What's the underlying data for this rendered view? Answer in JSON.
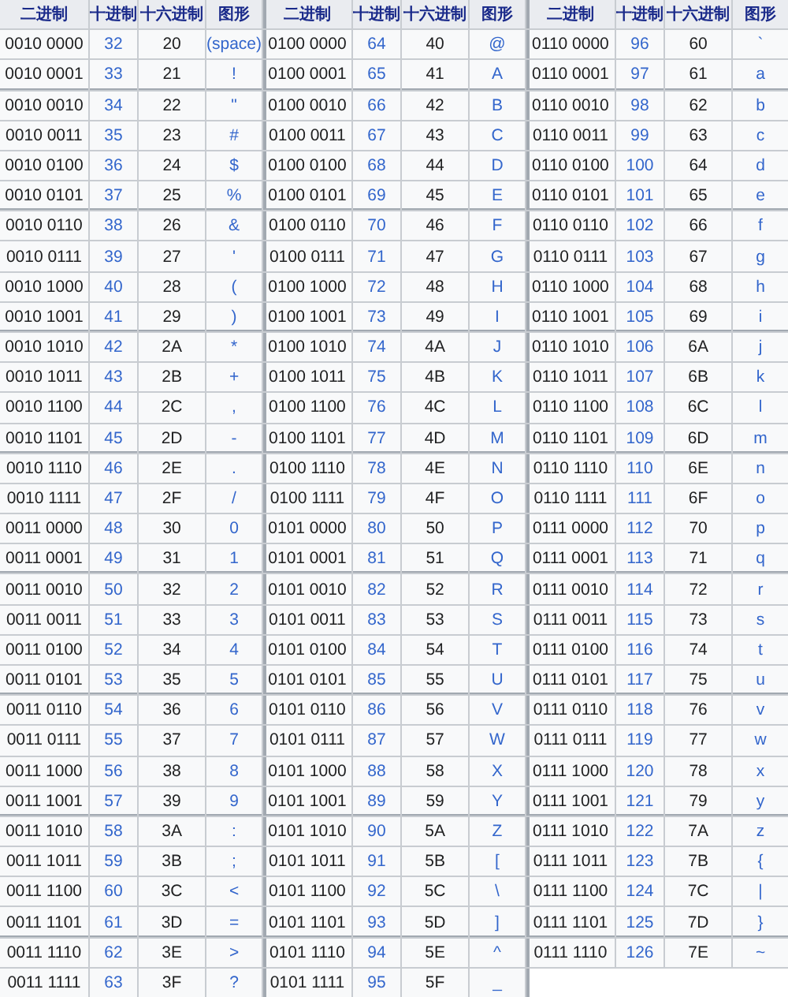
{
  "groups": [
    {
      "columns": [
        "二进制",
        "十进制",
        "十六进制",
        "图形"
      ],
      "rows": [
        [
          "0010 0000",
          "32",
          "20",
          "(space)"
        ],
        [
          "0010 0001",
          "33",
          "21",
          "!"
        ],
        [
          "0010 0010",
          "34",
          "22",
          "\""
        ],
        [
          "0010 0011",
          "35",
          "23",
          "#"
        ],
        [
          "0010 0100",
          "36",
          "24",
          "$"
        ],
        [
          "0010 0101",
          "37",
          "25",
          "%"
        ],
        [
          "0010 0110",
          "38",
          "26",
          "&"
        ],
        [
          "0010 0111",
          "39",
          "27",
          "'"
        ],
        [
          "0010 1000",
          "40",
          "28",
          "("
        ],
        [
          "0010 1001",
          "41",
          "29",
          ")"
        ],
        [
          "0010 1010",
          "42",
          "2A",
          "*"
        ],
        [
          "0010 1011",
          "43",
          "2B",
          "+"
        ],
        [
          "0010 1100",
          "44",
          "2C",
          ","
        ],
        [
          "0010 1101",
          "45",
          "2D",
          "-"
        ],
        [
          "0010 1110",
          "46",
          "2E",
          "."
        ],
        [
          "0010 1111",
          "47",
          "2F",
          "/"
        ],
        [
          "0011 0000",
          "48",
          "30",
          "0"
        ],
        [
          "0011 0001",
          "49",
          "31",
          "1"
        ],
        [
          "0011 0010",
          "50",
          "32",
          "2"
        ],
        [
          "0011 0011",
          "51",
          "33",
          "3"
        ],
        [
          "0011 0100",
          "52",
          "34",
          "4"
        ],
        [
          "0011 0101",
          "53",
          "35",
          "5"
        ],
        [
          "0011 0110",
          "54",
          "36",
          "6"
        ],
        [
          "0011 0111",
          "55",
          "37",
          "7"
        ],
        [
          "0011 1000",
          "56",
          "38",
          "8"
        ],
        [
          "0011 1001",
          "57",
          "39",
          "9"
        ],
        [
          "0011 1010",
          "58",
          "3A",
          ":"
        ],
        [
          "0011 1011",
          "59",
          "3B",
          ";"
        ],
        [
          "0011 1100",
          "60",
          "3C",
          "<"
        ],
        [
          "0011 1101",
          "61",
          "3D",
          "="
        ],
        [
          "0011 1110",
          "62",
          "3E",
          ">"
        ],
        [
          "0011 1111",
          "63",
          "3F",
          "?"
        ]
      ]
    },
    {
      "columns": [
        "二进制",
        "十进制",
        "十六进制",
        "图形"
      ],
      "rows": [
        [
          "0100 0000",
          "64",
          "40",
          "@"
        ],
        [
          "0100 0001",
          "65",
          "41",
          "A"
        ],
        [
          "0100 0010",
          "66",
          "42",
          "B"
        ],
        [
          "0100 0011",
          "67",
          "43",
          "C"
        ],
        [
          "0100 0100",
          "68",
          "44",
          "D"
        ],
        [
          "0100 0101",
          "69",
          "45",
          "E"
        ],
        [
          "0100 0110",
          "70",
          "46",
          "F"
        ],
        [
          "0100 0111",
          "71",
          "47",
          "G"
        ],
        [
          "0100 1000",
          "72",
          "48",
          "H"
        ],
        [
          "0100 1001",
          "73",
          "49",
          "I"
        ],
        [
          "0100 1010",
          "74",
          "4A",
          "J"
        ],
        [
          "0100 1011",
          "75",
          "4B",
          "K"
        ],
        [
          "0100 1100",
          "76",
          "4C",
          "L"
        ],
        [
          "0100 1101",
          "77",
          "4D",
          "M"
        ],
        [
          "0100 1110",
          "78",
          "4E",
          "N"
        ],
        [
          "0100 1111",
          "79",
          "4F",
          "O"
        ],
        [
          "0101 0000",
          "80",
          "50",
          "P"
        ],
        [
          "0101 0001",
          "81",
          "51",
          "Q"
        ],
        [
          "0101 0010",
          "82",
          "52",
          "R"
        ],
        [
          "0101 0011",
          "83",
          "53",
          "S"
        ],
        [
          "0101 0100",
          "84",
          "54",
          "T"
        ],
        [
          "0101 0101",
          "85",
          "55",
          "U"
        ],
        [
          "0101 0110",
          "86",
          "56",
          "V"
        ],
        [
          "0101 0111",
          "87",
          "57",
          "W"
        ],
        [
          "0101 1000",
          "88",
          "58",
          "X"
        ],
        [
          "0101 1001",
          "89",
          "59",
          "Y"
        ],
        [
          "0101 1010",
          "90",
          "5A",
          "Z"
        ],
        [
          "0101 1011",
          "91",
          "5B",
          "["
        ],
        [
          "0101 1100",
          "92",
          "5C",
          "\\"
        ],
        [
          "0101 1101",
          "93",
          "5D",
          "]"
        ],
        [
          "0101 1110",
          "94",
          "5E",
          "^"
        ],
        [
          "0101 1111",
          "95",
          "5F",
          "_"
        ]
      ]
    },
    {
      "columns": [
        "二进制",
        "十进制",
        "十六进制",
        "图形"
      ],
      "rows": [
        [
          "0110 0000",
          "96",
          "60",
          "`"
        ],
        [
          "0110 0001",
          "97",
          "61",
          "a"
        ],
        [
          "0110 0010",
          "98",
          "62",
          "b"
        ],
        [
          "0110 0011",
          "99",
          "63",
          "c"
        ],
        [
          "0110 0100",
          "100",
          "64",
          "d"
        ],
        [
          "0110 0101",
          "101",
          "65",
          "e"
        ],
        [
          "0110 0110",
          "102",
          "66",
          "f"
        ],
        [
          "0110 0111",
          "103",
          "67",
          "g"
        ],
        [
          "0110 1000",
          "104",
          "68",
          "h"
        ],
        [
          "0110 1001",
          "105",
          "69",
          "i"
        ],
        [
          "0110 1010",
          "106",
          "6A",
          "j"
        ],
        [
          "0110 1011",
          "107",
          "6B",
          "k"
        ],
        [
          "0110 1100",
          "108",
          "6C",
          "l"
        ],
        [
          "0110 1101",
          "109",
          "6D",
          "m"
        ],
        [
          "0110 1110",
          "110",
          "6E",
          "n"
        ],
        [
          "0110 1111",
          "111",
          "6F",
          "o"
        ],
        [
          "0111 0000",
          "112",
          "70",
          "p"
        ],
        [
          "0111 0001",
          "113",
          "71",
          "q"
        ],
        [
          "0111 0010",
          "114",
          "72",
          "r"
        ],
        [
          "0111 0011",
          "115",
          "73",
          "s"
        ],
        [
          "0111 0100",
          "116",
          "74",
          "t"
        ],
        [
          "0111 0101",
          "117",
          "75",
          "u"
        ],
        [
          "0111 0110",
          "118",
          "76",
          "v"
        ],
        [
          "0111 0111",
          "119",
          "77",
          "w"
        ],
        [
          "0111 1000",
          "120",
          "78",
          "x"
        ],
        [
          "0111 1001",
          "121",
          "79",
          "y"
        ],
        [
          "0111 1010",
          "122",
          "7A",
          "z"
        ],
        [
          "0111 1011",
          "123",
          "7B",
          "{"
        ],
        [
          "0111 1100",
          "124",
          "7C",
          "|"
        ],
        [
          "0111 1101",
          "125",
          "7D",
          "}"
        ],
        [
          "0111 1110",
          "126",
          "7E",
          "~"
        ]
      ]
    }
  ]
}
